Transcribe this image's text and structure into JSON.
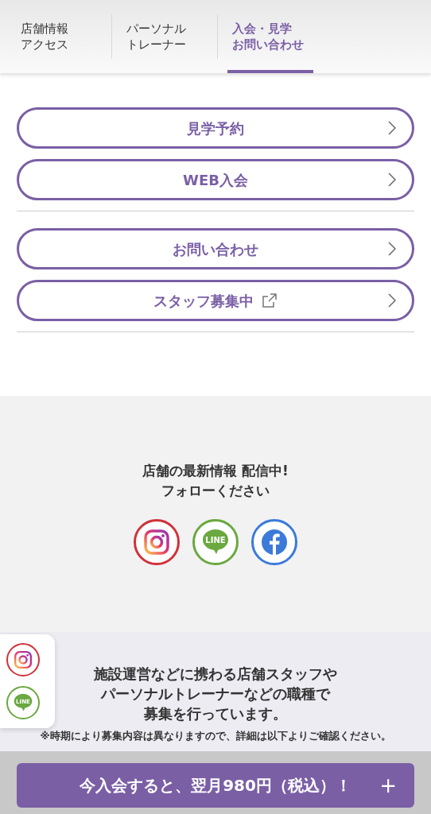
{
  "tabs": [
    {
      "lines": [
        "店舗情報",
        "アクセス"
      ],
      "selected": false
    },
    {
      "lines": [
        "パーソナル",
        "トレーナー"
      ],
      "selected": false
    },
    {
      "lines": [
        "入会・見学",
        "お問い合わせ"
      ],
      "selected": true
    }
  ],
  "menu_groups": [
    [
      {
        "label": "見学予約",
        "external": false
      },
      {
        "label": "WEB入会",
        "external": false
      }
    ],
    [
      {
        "label": "お問い合わせ",
        "external": false
      },
      {
        "label": "スタッフ募集中",
        "external": true
      }
    ]
  ],
  "follow": {
    "lines": [
      "店舗の最新情報 配信中!",
      "フォローください"
    ],
    "social": [
      {
        "kind": "instagram"
      },
      {
        "kind": "line",
        "label": "LINE"
      },
      {
        "kind": "facebook"
      }
    ]
  },
  "side_panel": [
    {
      "kind": "instagram"
    },
    {
      "kind": "line",
      "label": "LINE"
    }
  ],
  "recruit": {
    "lines": [
      "施設運営などに携わる店舗スタッフや",
      "パーソナルトレーナーなどの職種で",
      "募集を行っています。"
    ],
    "note": "※時期により募集内容は異なりますので、詳細は以下よりご確認ください。"
  },
  "cta": {
    "label": "今入会すると、翌月980円（税込）！",
    "toggle": "+"
  }
}
